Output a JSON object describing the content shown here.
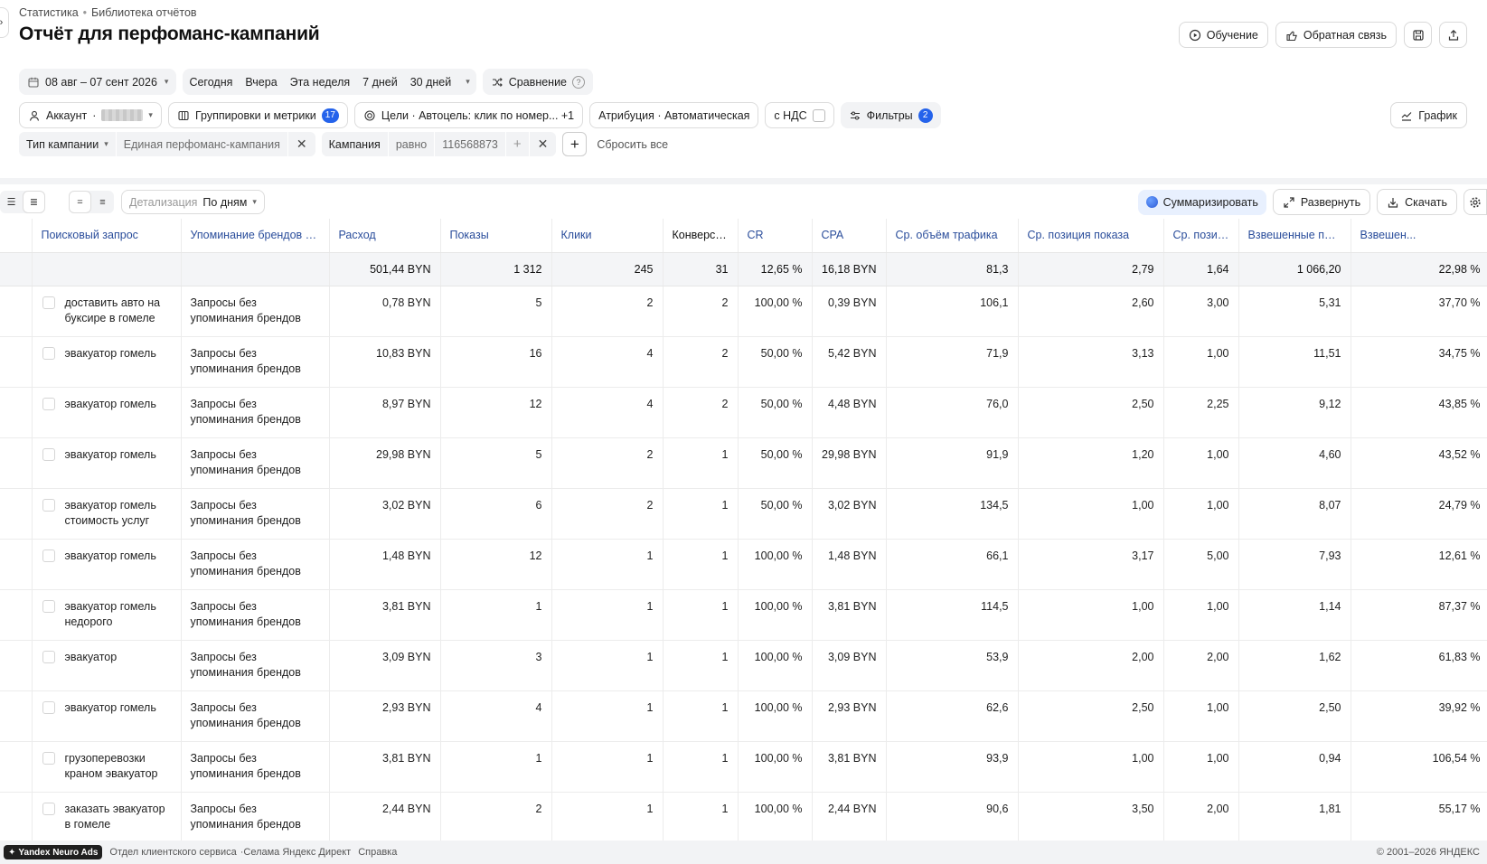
{
  "breadcrumb": [
    "Статистика",
    "Библиотека отчётов"
  ],
  "title": "Отчёт для перфоманс-кампаний",
  "header_actions": {
    "learning": "Обучение",
    "feedback": "Обратная связь"
  },
  "period": {
    "range": "08 авг – 07 сент 2026",
    "presets": [
      "Сегодня",
      "Вчера",
      "Эта неделя",
      "7 дней",
      "30 дней"
    ],
    "compare": "Сравнение"
  },
  "settings": {
    "account_label": "Аккаунт",
    "groupings": "Группировки и метрики",
    "groupings_count": "17",
    "goals": "Цели · Автоцель: клик по номер... +1",
    "attribution": "Атрибуция · Автоматическая",
    "vat": "с НДС",
    "filters": "Фильтры",
    "filters_count": "2",
    "graph": "График"
  },
  "filters": [
    {
      "field": "Тип кампании",
      "value": "Единая перфоманс-кампания"
    },
    {
      "field": "Кампания",
      "op": "равно",
      "value": "116568873"
    }
  ],
  "reset_all": "Сбросить все",
  "toolbar": {
    "detail_label": "Детализация",
    "detail_value": "По дням",
    "summarize": "Суммаризировать",
    "expand": "Развернуть",
    "download": "Скачать"
  },
  "table": {
    "columns": [
      "Поисковый запрос",
      "Упоминание брендов в з...",
      "Расход",
      "Показы",
      "Клики",
      "Конверсии↓",
      "CR",
      "CPA",
      "Ср. объём трафика",
      "Ср. позиция показа",
      "Ср. позиц...",
      "Взвешенные пок...",
      "Взвешен..."
    ],
    "total": [
      "",
      "",
      "501,44 BYN",
      "1 312",
      "245",
      "31",
      "12,65 %",
      "16,18 BYN",
      "81,3",
      "2,79",
      "1,64",
      "1 066,20",
      "22,98 %"
    ],
    "rows": [
      [
        "доставить авто на буксире в гомеле",
        "Запросы без упоминания брендов",
        "0,78 BYN",
        "5",
        "2",
        "2",
        "100,00 %",
        "0,39 BYN",
        "106,1",
        "2,60",
        "3,00",
        "5,31",
        "37,70 %"
      ],
      [
        "эвакуатор гомель",
        "Запросы без упоминания брендов",
        "10,83 BYN",
        "16",
        "4",
        "2",
        "50,00 %",
        "5,42 BYN",
        "71,9",
        "3,13",
        "1,00",
        "11,51",
        "34,75 %"
      ],
      [
        "эвакуатор гомель",
        "Запросы без упоминания брендов",
        "8,97 BYN",
        "12",
        "4",
        "2",
        "50,00 %",
        "4,48 BYN",
        "76,0",
        "2,50",
        "2,25",
        "9,12",
        "43,85 %"
      ],
      [
        "эвакуатор гомель",
        "Запросы без упоминания брендов",
        "29,98 BYN",
        "5",
        "2",
        "1",
        "50,00 %",
        "29,98 BYN",
        "91,9",
        "1,20",
        "1,00",
        "4,60",
        "43,52 %"
      ],
      [
        "эвакуатор гомель стоимость услуг",
        "Запросы без упоминания брендов",
        "3,02 BYN",
        "6",
        "2",
        "1",
        "50,00 %",
        "3,02 BYN",
        "134,5",
        "1,00",
        "1,00",
        "8,07",
        "24,79 %"
      ],
      [
        "эвакуатор гомель",
        "Запросы без упоминания брендов",
        "1,48 BYN",
        "12",
        "1",
        "1",
        "100,00 %",
        "1,48 BYN",
        "66,1",
        "3,17",
        "5,00",
        "7,93",
        "12,61 %"
      ],
      [
        "эвакуатор гомель недорого",
        "Запросы без упоминания брендов",
        "3,81 BYN",
        "1",
        "1",
        "1",
        "100,00 %",
        "3,81 BYN",
        "114,5",
        "1,00",
        "1,00",
        "1,14",
        "87,37 %"
      ],
      [
        "эвакуатор",
        "Запросы без упоминания брендов",
        "3,09 BYN",
        "3",
        "1",
        "1",
        "100,00 %",
        "3,09 BYN",
        "53,9",
        "2,00",
        "2,00",
        "1,62",
        "61,83 %"
      ],
      [
        "эвакуатор гомель",
        "Запросы без упоминания брендов",
        "2,93 BYN",
        "4",
        "1",
        "1",
        "100,00 %",
        "2,93 BYN",
        "62,6",
        "2,50",
        "1,00",
        "2,50",
        "39,92 %"
      ],
      [
        "грузоперевозки краном эвакуатор",
        "Запросы без упоминания брендов",
        "3,81 BYN",
        "1",
        "1",
        "1",
        "100,00 %",
        "3,81 BYN",
        "93,9",
        "1,00",
        "1,00",
        "0,94",
        "106,54 %"
      ],
      [
        "заказать эвакуатор в гомеле",
        "Запросы без упоминания брендов",
        "2,44 BYN",
        "2",
        "1",
        "1",
        "100,00 %",
        "2,44 BYN",
        "90,6",
        "3,50",
        "2,00",
        "1,81",
        "55,17 %"
      ]
    ]
  },
  "footer": {
    "brand": "Yandex Neuro Ads",
    "links": [
      "Отдел клиентского сервиса",
      "·Селама Яндекс Директ",
      "Справка"
    ],
    "copyright": "© 2001–2026 ЯНДЕКС"
  }
}
